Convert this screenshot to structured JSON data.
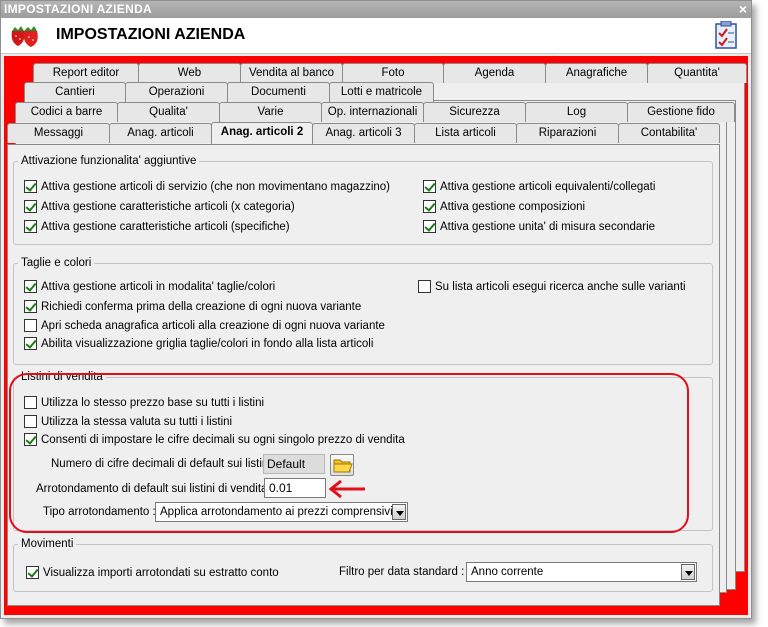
{
  "window": {
    "title": "IMPOSTAZIONI AZIENDA",
    "close_glyph": "×"
  },
  "header": {
    "title": "IMPOSTAZIONI AZIENDA",
    "logo_icon": "strawberries-icon",
    "checklist_icon": "checklist-icon"
  },
  "tabs": {
    "row1": [
      "Report editor",
      "Web",
      "Vendita al banco",
      "Foto",
      "Agenda",
      "Anagrafiche",
      "Quantita'"
    ],
    "row2": [
      "Cantieri",
      "Operazioni",
      "Documenti",
      "Lotti e matricole"
    ],
    "row3": [
      "Codici a barre",
      "Qualita'",
      "Varie",
      "Op. internazionali",
      "Sicurezza",
      "Log",
      "Gestione fido"
    ],
    "row4": [
      "Messaggi",
      "Anag. articoli",
      "Anag. articoli 2",
      "Anag. articoli 3",
      "Lista articoli",
      "Riparazioni",
      "Contabilita'"
    ],
    "active": "Anag. articoli 2"
  },
  "attivazione": {
    "legend": "Attivazione funzionalita' aggiuntive",
    "items": [
      {
        "label": "Attiva gestione articoli di servizio (che non movimentano magazzino)",
        "checked": true
      },
      {
        "label": "Attiva gestione caratteristiche articoli (x categoria)",
        "checked": true
      },
      {
        "label": "Attiva gestione caratteristiche articoli (specifiche)",
        "checked": true
      },
      {
        "label": "Attiva gestione articoli equivalenti/collegati",
        "checked": true
      },
      {
        "label": "Attiva gestione composizioni",
        "checked": true
      },
      {
        "label": "Attiva gestione unita' di misura secondarie",
        "checked": true
      }
    ]
  },
  "taglie": {
    "legend": "Taglie e colori",
    "items": [
      {
        "label": "Attiva gestione articoli in modalita' taglie/colori",
        "checked": true
      },
      {
        "label": "Richiedi conferma prima della creazione di ogni nuova variante",
        "checked": true
      },
      {
        "label": "Apri scheda anagrafica articoli alla creazione di ogni nuova variante",
        "checked": false
      },
      {
        "label": "Abilita visualizzazione griglia taglie/colori in fondo alla lista articoli",
        "checked": true
      },
      {
        "label": "Su lista articoli esegui ricerca anche sulle varianti",
        "checked": false
      }
    ]
  },
  "listini": {
    "legend": "Listini di vendita",
    "items": [
      {
        "label": "Utilizza lo stesso prezzo base su tutti i listini",
        "checked": false
      },
      {
        "label": "Utilizza la stessa valuta su tutti i listini",
        "checked": false
      },
      {
        "label": "Consenti di impostare le cifre decimali su ogni singolo prezzo di vendita",
        "checked": true
      }
    ],
    "decimali_label": "Numero di cifre decimali di default sui listini :",
    "decimali_value": "Default",
    "arrotondamento_label": "Arrotondamento di default sui listini di vendita :",
    "arrotondamento_value": "0.01",
    "tipo_label": "Tipo arrotondamento :",
    "tipo_value": "Applica arrotondamento ai prezzi comprensivi di"
  },
  "movimenti": {
    "legend": "Movimenti",
    "visualizza_label": "Visualizza importi arrotondati su estratto conto",
    "visualizza_checked": true,
    "filtro_label": "Filtro per data standard :",
    "filtro_value": "Anno corrente"
  },
  "colors": {
    "accent_red": "#ff0000",
    "annotation_red": "#e0101a",
    "check_green": "#1a7a1a"
  }
}
